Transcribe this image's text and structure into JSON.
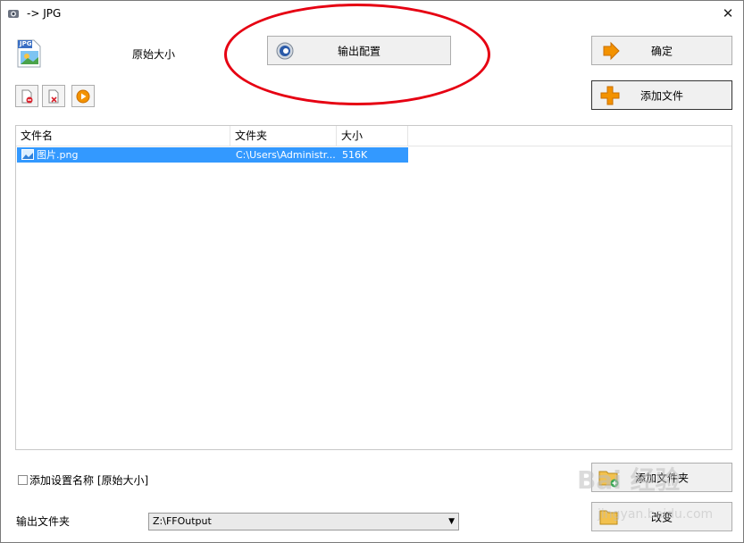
{
  "window": {
    "title": "-> JPG",
    "close_glyph": "✕"
  },
  "profile": {
    "icon": "jpg-file-icon",
    "icon_text": "JPG",
    "label": "原始大小"
  },
  "buttons": {
    "output_config": "输出配置",
    "ok": "确定",
    "add_file": "添加文件",
    "add_folder": "添加文件夹",
    "change": "改变"
  },
  "toolbar": {
    "remove": "remove-file-icon",
    "clear": "clear-list-icon",
    "play": "play-icon"
  },
  "file_list": {
    "columns": [
      "文件名",
      "文件夹",
      "大小"
    ],
    "rows": [
      {
        "name": "图片.png",
        "folder": "C:\\Users\\Administr...",
        "size": "516K"
      }
    ]
  },
  "options": {
    "add_setting_name_label": "添加设置名称 [原始大小]",
    "add_setting_name_checked": false
  },
  "output_folder": {
    "label": "输出文件夹",
    "value": "Z:\\FFOutput"
  },
  "watermark": {
    "main": "Bai 经验",
    "sub": "jingyan.baidu.com"
  },
  "colors": {
    "selection": "#3399ff",
    "annotation": "#e60012",
    "accent_orange": "#f39200"
  }
}
